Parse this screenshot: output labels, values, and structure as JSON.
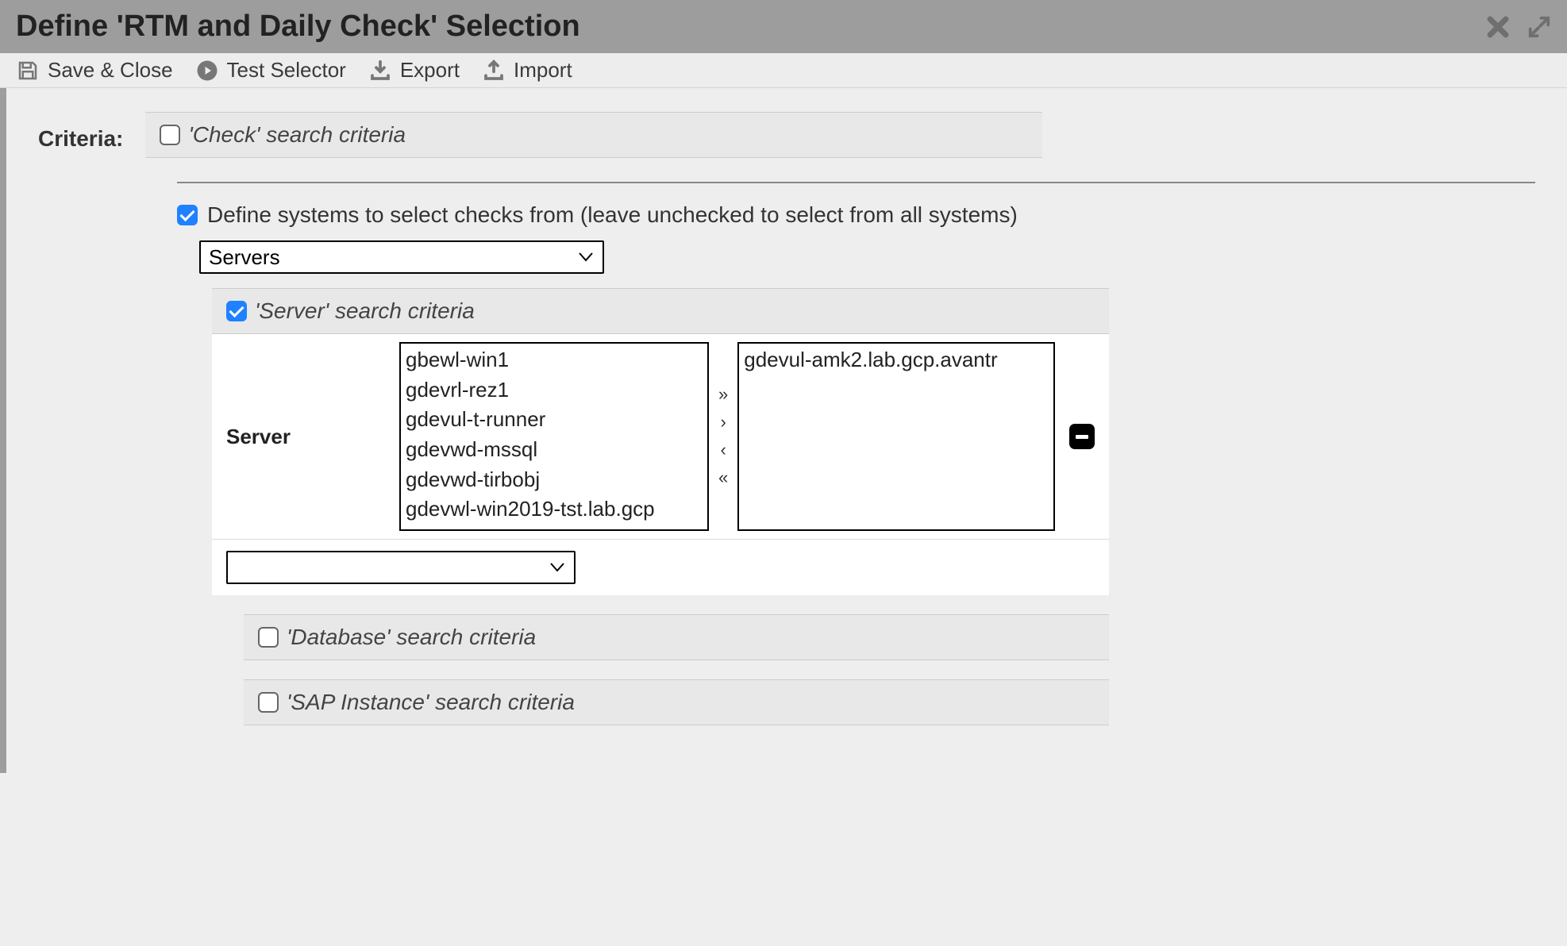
{
  "title": "Define 'RTM and Daily Check' Selection",
  "toolbar": {
    "save_close": "Save & Close",
    "test_selector": "Test Selector",
    "export": "Export",
    "import": "Import"
  },
  "criteria_label": "Criteria:",
  "check_criteria_label": "'Check' search criteria",
  "define_systems_label": "Define systems to select checks from (leave unchecked to select from all systems)",
  "systems_dropdown_value": "Servers",
  "server_criteria_label": "'Server' search criteria",
  "server_label": "Server",
  "available_servers": [
    "gbewl-win1",
    "gdevrl-rez1",
    "gdevul-t-runner",
    "gdevwd-mssql",
    "gdevwd-tirbobj",
    "gdevwl-win2019-tst.lab.gcp"
  ],
  "selected_servers": [
    "gdevul-amk2.lab.gcp.avantr"
  ],
  "database_criteria_label": "'Database' search criteria",
  "sap_criteria_label": "'SAP Instance' search criteria",
  "add_select_value": ""
}
